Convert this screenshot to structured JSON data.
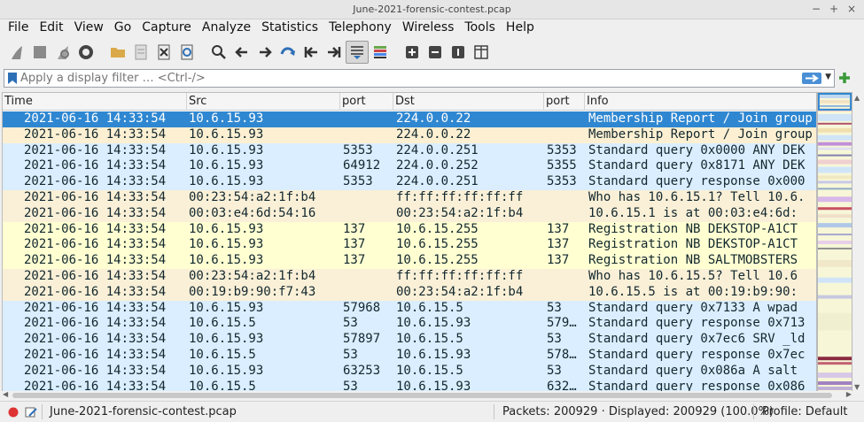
{
  "window": {
    "title": "June-2021-forensic-contest.pcap",
    "controls": [
      "−",
      "+",
      "×"
    ]
  },
  "menu": [
    "File",
    "Edit",
    "View",
    "Go",
    "Capture",
    "Analyze",
    "Statistics",
    "Telephony",
    "Wireless",
    "Tools",
    "Help"
  ],
  "toolbar": [
    {
      "name": "start-capture-icon"
    },
    {
      "name": "stop-capture-icon"
    },
    {
      "name": "restart-capture-icon"
    },
    {
      "name": "capture-options-icon"
    },
    {
      "sep": true
    },
    {
      "name": "open-file-icon"
    },
    {
      "name": "save-file-icon"
    },
    {
      "name": "close-file-icon"
    },
    {
      "name": "reload-file-icon"
    },
    {
      "sep": true
    },
    {
      "name": "find-packet-icon"
    },
    {
      "name": "go-back-icon"
    },
    {
      "name": "go-forward-icon"
    },
    {
      "name": "go-to-packet-icon"
    },
    {
      "name": "first-packet-icon"
    },
    {
      "name": "last-packet-icon"
    },
    {
      "name": "autoscroll-icon",
      "active": true
    },
    {
      "name": "colorize-icon"
    },
    {
      "sep": true
    },
    {
      "name": "zoom-in-icon"
    },
    {
      "name": "zoom-out-icon"
    },
    {
      "name": "zoom-normal-icon"
    },
    {
      "name": "resize-columns-icon"
    }
  ],
  "filter": {
    "placeholder": "Apply a display filter … <Ctrl-/>",
    "value": ""
  },
  "columns": [
    {
      "key": "time",
      "label": "Time"
    },
    {
      "key": "src",
      "label": "Src"
    },
    {
      "key": "sport",
      "label": "port"
    },
    {
      "key": "dst",
      "label": "Dst"
    },
    {
      "key": "dport",
      "label": "port"
    },
    {
      "key": "info",
      "label": "Info"
    }
  ],
  "colors": {
    "selected": "#2f87d1",
    "multicast": "#fdf0d2",
    "udp": "#daeeff",
    "arp": "#faf0d7",
    "nbns": "#ffffd2"
  },
  "packets": [
    {
      "time": "2021-06-16 14:33:54",
      "src": "10.6.15.93",
      "sport": "",
      "dst": "224.0.0.22",
      "dport": "",
      "info": "Membership Report / Join group",
      "color": "selected"
    },
    {
      "time": "2021-06-16 14:33:54",
      "src": "10.6.15.93",
      "sport": "",
      "dst": "224.0.0.22",
      "dport": "",
      "info": "Membership Report / Join group",
      "color": "multicast"
    },
    {
      "time": "2021-06-16 14:33:54",
      "src": "10.6.15.93",
      "sport": "5353",
      "dst": "224.0.0.251",
      "dport": "5353",
      "info": "Standard query 0x0000 ANY DEK",
      "color": "udp"
    },
    {
      "time": "2021-06-16 14:33:54",
      "src": "10.6.15.93",
      "sport": "64912",
      "dst": "224.0.0.252",
      "dport": "5355",
      "info": "Standard query 0x8171 ANY DEK",
      "color": "udp"
    },
    {
      "time": "2021-06-16 14:33:54",
      "src": "10.6.15.93",
      "sport": "5353",
      "dst": "224.0.0.251",
      "dport": "5353",
      "info": "Standard query response 0x000",
      "color": "udp"
    },
    {
      "time": "2021-06-16 14:33:54",
      "src": "00:23:54:a2:1f:b4",
      "sport": "",
      "dst": "ff:ff:ff:ff:ff:ff",
      "dport": "",
      "info": "Who has 10.6.15.1? Tell 10.6.",
      "color": "arp"
    },
    {
      "time": "2021-06-16 14:33:54",
      "src": "00:03:e4:6d:54:16",
      "sport": "",
      "dst": "00:23:54:a2:1f:b4",
      "dport": "",
      "info": "10.6.15.1 is at 00:03:e4:6d:",
      "color": "arp"
    },
    {
      "time": "2021-06-16 14:33:54",
      "src": "10.6.15.93",
      "sport": "137",
      "dst": "10.6.15.255",
      "dport": "137",
      "info": "Registration NB DEKSTOP-A1CT",
      "color": "nbns"
    },
    {
      "time": "2021-06-16 14:33:54",
      "src": "10.6.15.93",
      "sport": "137",
      "dst": "10.6.15.255",
      "dport": "137",
      "info": "Registration NB DEKSTOP-A1CT",
      "color": "nbns"
    },
    {
      "time": "2021-06-16 14:33:54",
      "src": "10.6.15.93",
      "sport": "137",
      "dst": "10.6.15.255",
      "dport": "137",
      "info": "Registration NB SALTMOBSTERS",
      "color": "nbns"
    },
    {
      "time": "2021-06-16 14:33:54",
      "src": "00:23:54:a2:1f:b4",
      "sport": "",
      "dst": "ff:ff:ff:ff:ff:ff",
      "dport": "",
      "info": "Who has 10.6.15.5? Tell 10.6",
      "color": "arp"
    },
    {
      "time": "2021-06-16 14:33:54",
      "src": "00:19:b9:90:f7:43",
      "sport": "",
      "dst": "00:23:54:a2:1f:b4",
      "dport": "",
      "info": "10.6.15.5 is at 00:19:b9:90:",
      "color": "arp"
    },
    {
      "time": "2021-06-16 14:33:54",
      "src": "10.6.15.93",
      "sport": "57968",
      "dst": "10.6.15.5",
      "dport": "53",
      "info": "Standard query 0x7133 A wpad",
      "color": "udp"
    },
    {
      "time": "2021-06-16 14:33:54",
      "src": "10.6.15.5",
      "sport": "53",
      "dst": "10.6.15.93",
      "dport": "579…",
      "info": "Standard query response 0x713",
      "color": "udp"
    },
    {
      "time": "2021-06-16 14:33:54",
      "src": "10.6.15.93",
      "sport": "57897",
      "dst": "10.6.15.5",
      "dport": "53",
      "info": "Standard query 0x7ec6 SRV _ld",
      "color": "udp"
    },
    {
      "time": "2021-06-16 14:33:54",
      "src": "10.6.15.5",
      "sport": "53",
      "dst": "10.6.15.93",
      "dport": "578…",
      "info": "Standard query response 0x7ec",
      "color": "udp"
    },
    {
      "time": "2021-06-16 14:33:54",
      "src": "10.6.15.93",
      "sport": "63253",
      "dst": "10.6.15.5",
      "dport": "53",
      "info": "Standard query 0x086a A salt",
      "color": "udp"
    },
    {
      "time": "2021-06-16 14:33:54",
      "src": "10.6.15.5",
      "sport": "53",
      "dst": "10.6.15.93",
      "dport": "632…",
      "info": "Standard query response 0x086",
      "color": "udp"
    }
  ],
  "status": {
    "file": "June-2021-forensic-contest.pcap",
    "packets": "Packets: 200929 · Displayed: 200929 (100.0%)",
    "profile": "Profile: Default"
  }
}
